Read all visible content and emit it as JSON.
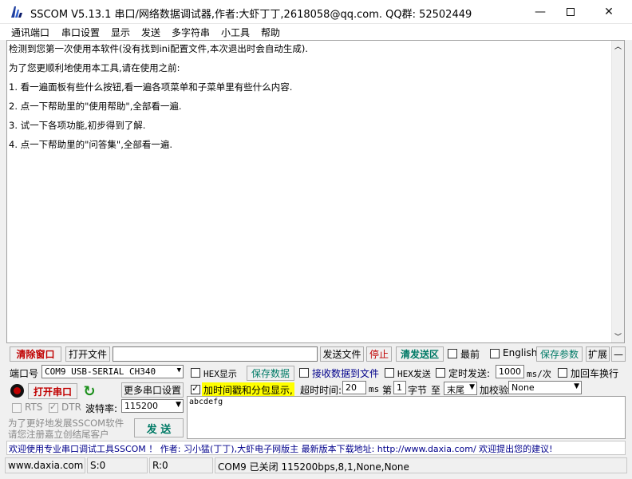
{
  "window": {
    "title": "SSCOM V5.13.1 串口/网络数据调试器,作者:大虾丁丁,2618058@qq.com. QQ群: 52502449",
    "minimize_icon": "minimize-icon",
    "maximize_icon": "maximize-icon",
    "close_icon": "close-icon"
  },
  "menu": {
    "items": [
      "通讯端口",
      "串口设置",
      "显示",
      "发送",
      "多字符串",
      "小工具",
      "帮助"
    ]
  },
  "receive": {
    "lines": [
      "检测到您第一次使用本软件(没有找到ini配置文件,本次退出时会自动生成).",
      "为了您更顺利地使用本工具,请在使用之前:",
      "1. 看一遍面板有些什么按钮,看一遍各项菜单和子菜单里有些什么内容.",
      "2. 点一下帮助里的\"使用帮助\",全部看一遍.",
      "3. 试一下各项功能,初步得到了解.",
      "4. 点一下帮助里的\"问答集\",全部看一遍."
    ]
  },
  "toolbar1": {
    "clear_window": "清除窗口",
    "open_file": "打开文件",
    "send_file": "发送文件",
    "stop": "停止",
    "clear_send": "清发送区",
    "topmost": "最前",
    "english": "English",
    "save_params": "保存参数",
    "expand": "扩展",
    "collapse": "—"
  },
  "port": {
    "label": "端口号",
    "value": "COM9 USB-SERIAL CH340",
    "open_button": "打开串口",
    "more_settings": "更多串口设置",
    "rts": "RTS",
    "dtr": "DTR",
    "baud_label": "波特率:",
    "baud_value": "115200"
  },
  "options": {
    "hex_display": "HEX显示",
    "save_data": "保存数据",
    "recv_to_file": "接收数据到文件",
    "hex_send": "HEX发送",
    "timed_send": "定时发送:",
    "timed_value": "1000",
    "timed_unit": "ms/次",
    "add_crlf": "加回车换行",
    "timestamp": "加时间戳和分包显示,",
    "timeout_label": "超时时间:",
    "timeout_value": "20",
    "timeout_unit": "ms",
    "packet_prefix": "第",
    "packet_value": "1",
    "packet_unit": "字节",
    "to_label": "至",
    "to_value": "末尾",
    "checksum_label": "加校验",
    "checksum_value": "None"
  },
  "promo": {
    "line1": "为了更好地发展SSCOM软件",
    "line2": "请您注册嘉立创结尾客户"
  },
  "send": {
    "button": "发 送",
    "text": "abcdefg"
  },
  "marquee": {
    "text": "欢迎使用专业串口调试工具SSCOM ！ 作者: 习小猛(丁丁),大虾电子网版主 最新版本下载地址: http://www.daxia.com/ 欢迎提出您的建议!"
  },
  "status": {
    "website": "www.daxia.com",
    "sent": "S:0",
    "received": "R:0",
    "port_state": "COM9 已关闭  115200bps,8,1,None,None"
  },
  "colors": {
    "accent_red": "#c00000",
    "accent_teal": "#007a66",
    "highlight_yellow": "#ffff00",
    "marquee_blue": "#00008b"
  }
}
